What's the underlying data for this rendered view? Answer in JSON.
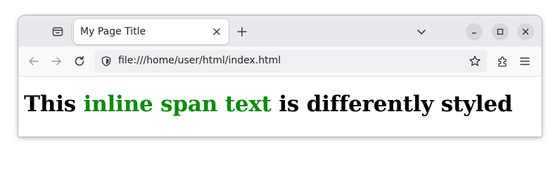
{
  "browser": {
    "tab": {
      "title": "My Page Title"
    },
    "url": "file:///home/user/html/index.html"
  },
  "page": {
    "heading_before": "This ",
    "heading_span": "inline span text",
    "heading_after": " is differently styled"
  },
  "colors": {
    "span_text": "#0a8a0a",
    "tabbar_bg": "#e9e9ed",
    "navbar_bg": "#f9f9fb",
    "urlbar_bg": "#f0f0f4"
  },
  "icons": {
    "tab_overview": "tab-overview-icon",
    "tab_close": "close-icon",
    "new_tab": "plus-icon",
    "list_tabs": "chevron-down-icon",
    "minimize": "minimize-icon",
    "maximize": "maximize-icon",
    "close_window": "close-icon",
    "back": "back-arrow-icon",
    "forward": "forward-arrow-icon",
    "reload": "reload-icon",
    "site_info": "shield-icon",
    "bookmark": "star-icon",
    "extensions": "puzzle-icon",
    "menu": "hamburger-menu-icon"
  }
}
